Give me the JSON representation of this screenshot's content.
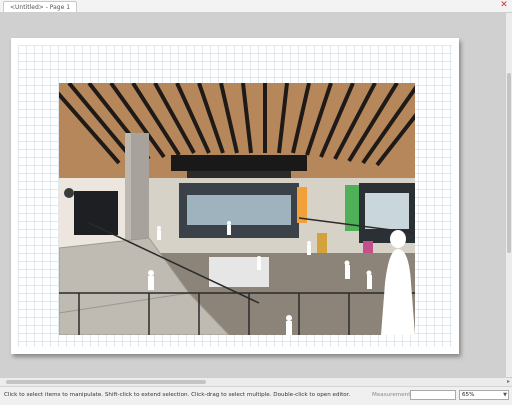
{
  "document": {
    "tab_title": "<Untitled> - Page 1",
    "close_icon": "close-icon"
  },
  "canvas": {
    "page": "page-1",
    "image_description_icon": "rendered-atrium-image"
  },
  "statusbar": {
    "message": "Click to select items to manipulate. Shift-click to extend selection. Click-drag to select multiple. Double-click to open editor.",
    "measurements_label": "Measurements",
    "measurements_value": "",
    "zoom": "65%"
  },
  "colors": {
    "canvas_bg": "#d0d0d0",
    "page_bg": "#ffffff",
    "grid_line": "#dfe8ef",
    "close_red": "#c0392b"
  }
}
